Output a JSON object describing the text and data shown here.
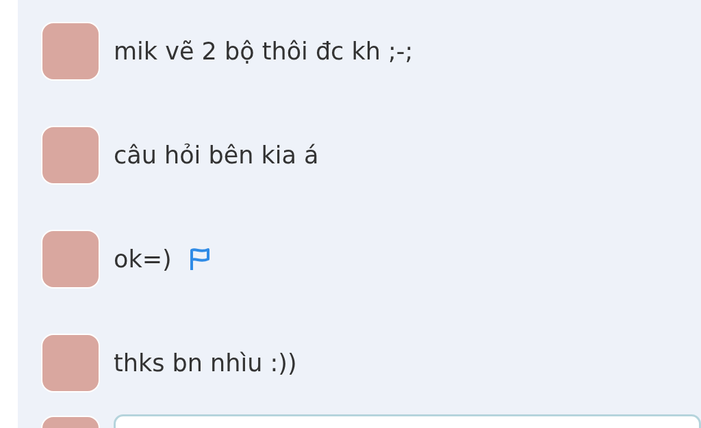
{
  "comments": [
    {
      "text": "mik vẽ 2 bộ thôi đc kh ;-;",
      "flagged": false
    },
    {
      "text": "câu hỏi bên kia á",
      "flagged": false
    },
    {
      "text": "ok=)",
      "flagged": true
    },
    {
      "text": "thks bn nhìu :))",
      "flagged": false
    }
  ]
}
